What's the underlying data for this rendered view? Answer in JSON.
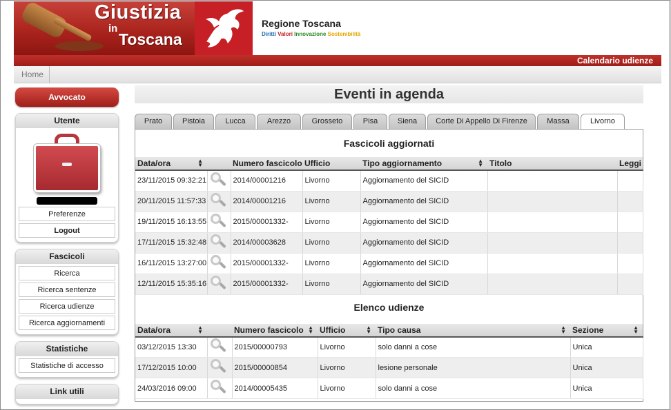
{
  "header": {
    "logo_line1": "Giustizia",
    "logo_line2": "in",
    "logo_line3": "Toscana",
    "region_name": "Regione Toscana",
    "tagline": [
      "Diritti",
      "Valori",
      "Innovazione",
      "Sostenibilità"
    ],
    "calendar_link": "Calendario udienze"
  },
  "breadcrumb": {
    "home": "Home"
  },
  "sidebar": {
    "role_button": "Avvocato",
    "user_box": {
      "title": "Utente",
      "preferences": "Preferenze",
      "logout": "Logout"
    },
    "fascicoli_box": {
      "title": "Fascicoli",
      "items": [
        "Ricerca",
        "Ricerca sentenze",
        "Ricerca udienze",
        "Ricerca aggiornamenti"
      ]
    },
    "stats_box": {
      "title": "Statistiche",
      "items": [
        "Statistiche di accesso"
      ]
    },
    "links_box": {
      "title": "Link utili"
    }
  },
  "main": {
    "title": "Eventi in agenda",
    "tabs": [
      "Prato",
      "Pistoia",
      "Lucca",
      "Arezzo",
      "Grosseto",
      "Pisa",
      "Siena",
      "Corte Di Appello Di Firenze",
      "Massa",
      "Livorno"
    ],
    "active_tab": "Livorno",
    "updates": {
      "title": "Fascicoli aggiornati",
      "columns": [
        "Data/ora",
        "",
        "Numero fascicolo",
        "Ufficio",
        "Tipo aggiornamento",
        "Titolo",
        "Leggi"
      ],
      "rows": [
        [
          "23/11/2015 09:32:21",
          "2014/00001216",
          "Livorno",
          "Aggiornamento del SICID"
        ],
        [
          "20/11/2015 11:57:33",
          "2014/00001216",
          "Livorno",
          "Aggiornamento del SICID"
        ],
        [
          "19/11/2015 16:13:55",
          "2015/00001332-",
          "Livorno",
          "Aggiornamento del SICID"
        ],
        [
          "17/11/2015 15:32:48",
          "2014/00003628",
          "Livorno",
          "Aggiornamento del SICID"
        ],
        [
          "16/11/2015 13:27:00",
          "2015/00001332-",
          "Livorno",
          "Aggiornamento del SICID"
        ],
        [
          "12/11/2015 15:35:16",
          "2015/00001332-",
          "Livorno",
          "Aggiornamento del SICID"
        ]
      ]
    },
    "hearings": {
      "title": "Elenco udienze",
      "columns": [
        "Data/ora",
        "",
        "Numero fascicolo",
        "Ufficio",
        "Tipo causa",
        "Sezione"
      ],
      "rows": [
        [
          "03/12/2015 13:30",
          "2015/00000793",
          "Livorno",
          "solo danni a cose",
          "Unica"
        ],
        [
          "17/12/2015 10:00",
          "2015/00000854",
          "Livorno",
          "lesione personale",
          "Unica"
        ],
        [
          "24/03/2016 09:00",
          "2014/00005435",
          "Livorno",
          "solo danni a cose",
          "Unica"
        ]
      ]
    }
  }
}
